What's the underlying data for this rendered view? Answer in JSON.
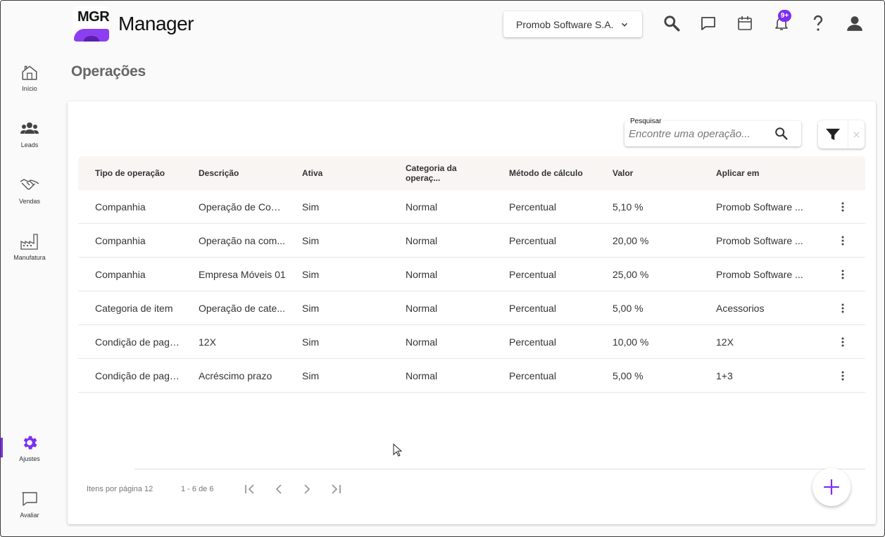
{
  "header": {
    "logo_text": "MGR",
    "app_title": "Manager",
    "company_selector": "Promob Software S.A.",
    "notification_badge": "9+",
    "icons": [
      "search-icon",
      "chat-icon",
      "calendar-icon",
      "bell-icon",
      "help-icon",
      "user-icon"
    ]
  },
  "sidebar": {
    "items": [
      {
        "label": "Início",
        "icon": "home-icon"
      },
      {
        "label": "Leads",
        "icon": "people-icon"
      },
      {
        "label": "Vendas",
        "icon": "handshake-icon"
      },
      {
        "label": "Manufatura",
        "icon": "factory-icon"
      },
      {
        "label": "Ajustes",
        "icon": "gear-icon",
        "active": true
      },
      {
        "label": "Avaliar",
        "icon": "feedback-icon"
      }
    ]
  },
  "page": {
    "title": "Operações"
  },
  "search": {
    "label": "Pesquisar",
    "placeholder": "Encontre uma operação..."
  },
  "table": {
    "columns": [
      "Tipo de operação",
      "Descrição",
      "Ativa",
      "Categoria da operaç...",
      "Método de cálculo",
      "Valor",
      "Aplicar em"
    ],
    "rows": [
      [
        "Companhia",
        "Operação de Com...",
        "Sim",
        "Normal",
        "Percentual",
        "5,10 %",
        "Promob Software ..."
      ],
      [
        "Companhia",
        "Operação na com...",
        "Sim",
        "Normal",
        "Percentual",
        "20,00 %",
        "Promob Software ..."
      ],
      [
        "Companhia",
        "Empresa Móveis 01",
        "Sim",
        "Normal",
        "Percentual",
        "25,00 %",
        "Promob Software ..."
      ],
      [
        "Categoria de item",
        "Operação de cate...",
        "Sim",
        "Normal",
        "Percentual",
        "5,00 %",
        "Acessorios"
      ],
      [
        "Condição de paga...",
        "12X",
        "Sim",
        "Normal",
        "Percentual",
        "10,00 %",
        "12X"
      ],
      [
        "Condição de paga...",
        "Acréscimo prazo",
        "Sim",
        "Normal",
        "Percentual",
        "5,00 %",
        "1+3"
      ]
    ]
  },
  "pagination": {
    "items_per_page": "Itens por página 12",
    "range": "1 - 6 de 6"
  },
  "colors": {
    "accent": "#7b2ff2",
    "header_row_bg": "#f8f5f3"
  }
}
